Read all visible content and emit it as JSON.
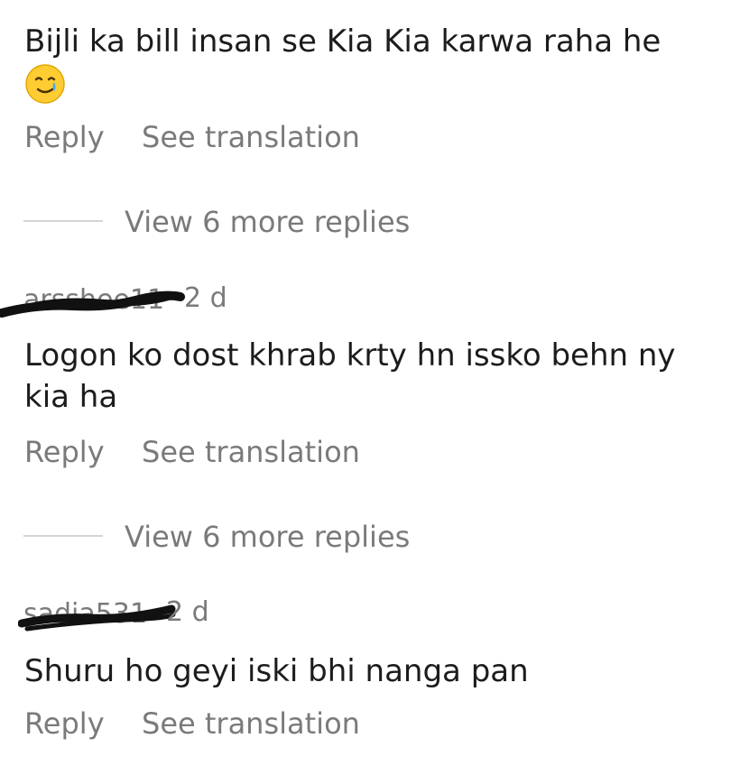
{
  "comments": [
    {
      "username": "",
      "timestamp": "",
      "text_line1": "Bijli ka bill insan se Kia Kia karwa raha he",
      "emoji": "🥲",
      "reply_label": "Reply",
      "translate_label": "See translation",
      "view_replies_label": "View 6 more replies"
    },
    {
      "username": "arsshee11",
      "timestamp": "2 d",
      "text_line1": "Logon ko dost khrab krty hn issko behn ny",
      "text_line2": "kia ha",
      "reply_label": "Reply",
      "translate_label": "See translation",
      "view_replies_label": "View 6 more replies"
    },
    {
      "username": "sadia531",
      "timestamp": "2 d",
      "text_line1": "Shuru ho geyi iski bhi nanga pan",
      "reply_label": "Reply",
      "translate_label": "See translation"
    }
  ],
  "colors": {
    "text": "#1c1c1c",
    "secondary": "#7a7a7a",
    "divider": "#d4d4d4",
    "redaction": "#111111"
  }
}
